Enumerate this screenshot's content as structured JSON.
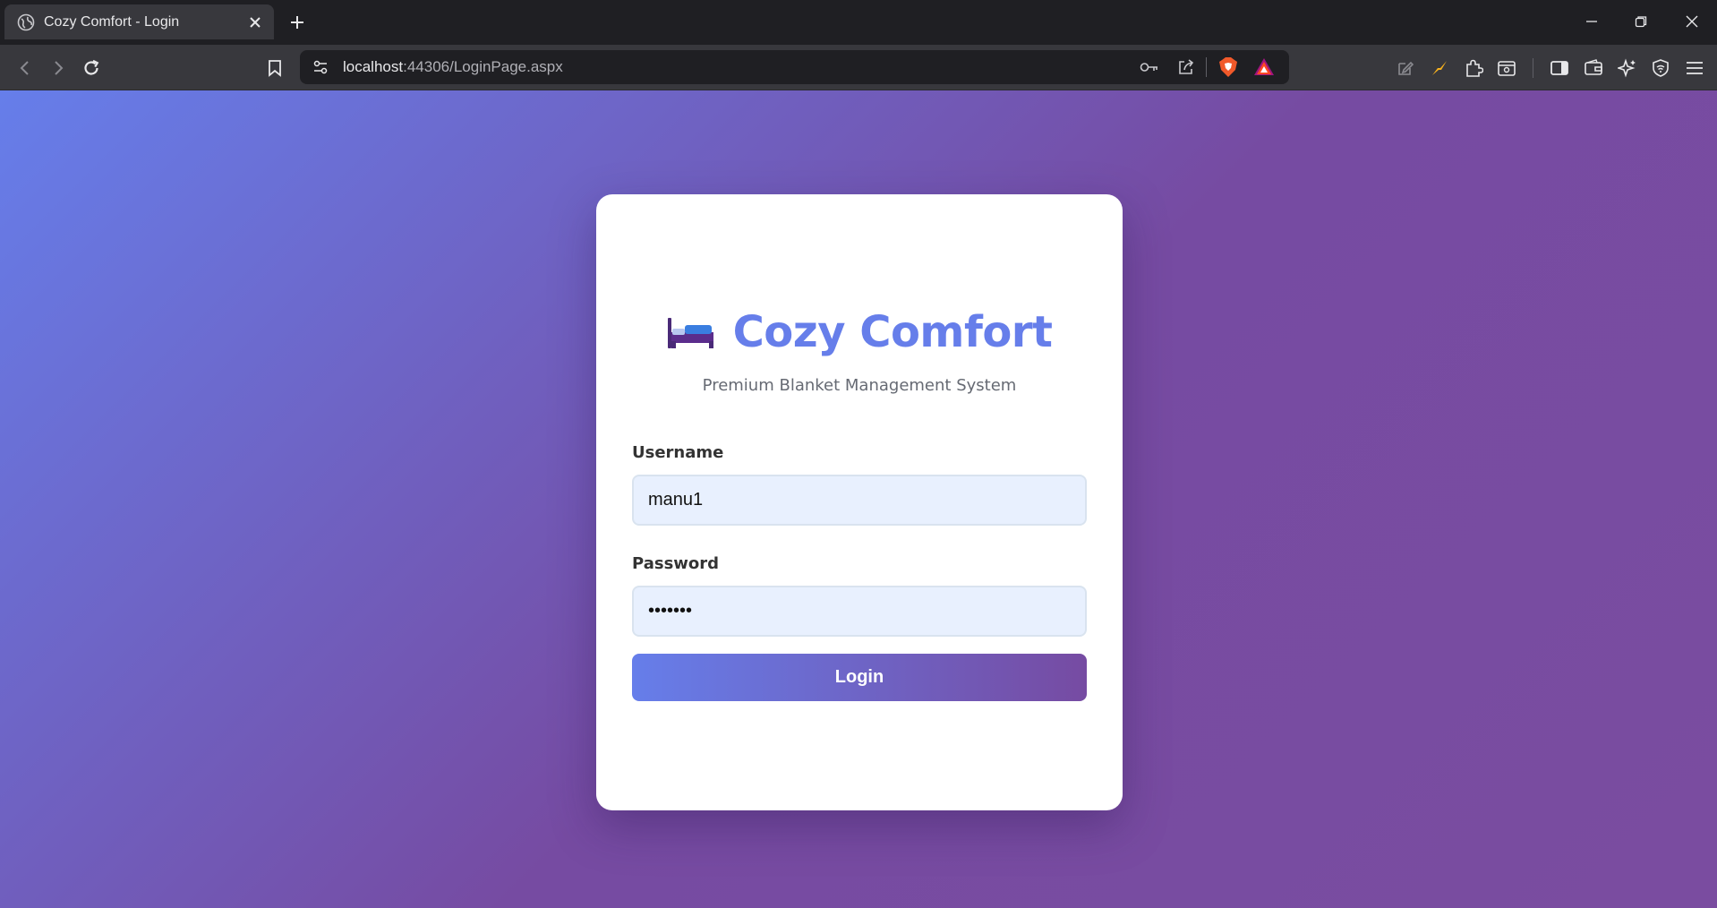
{
  "browser": {
    "tab_title": "Cozy Comfort - Login",
    "url_host": "localhost",
    "url_rest": ":44306/LoginPage.aspx",
    "icons": [
      "globe-icon",
      "close-icon",
      "plus-icon",
      "back-icon",
      "forward-icon",
      "reload-icon",
      "bookmark-icon",
      "site-info-icon",
      "key-icon",
      "share-icon",
      "brave-shields-icon",
      "brave-rewards-icon",
      "edit-icon",
      "lightning-extension-icon",
      "extensions-icon",
      "screenshot-icon",
      "sidebar-icon",
      "wallet-icon",
      "leo-ai-icon",
      "vpn-icon",
      "menu-icon",
      "minimize-icon",
      "restore-icon",
      "window-close-icon"
    ]
  },
  "login": {
    "brand_icon": "bed-icon",
    "title": "Cozy Comfort",
    "subtitle": "Premium Blanket Management System",
    "username_label": "Username",
    "username_value": "manu1",
    "password_label": "Password",
    "password_value": "manu123",
    "login_button": "Login"
  },
  "colors": {
    "accent": "#667eea",
    "accent_dark": "#764ba2",
    "input_bg": "#e8f0fe",
    "card_bg": "#ffffff",
    "browser_bg": "#38383d"
  }
}
